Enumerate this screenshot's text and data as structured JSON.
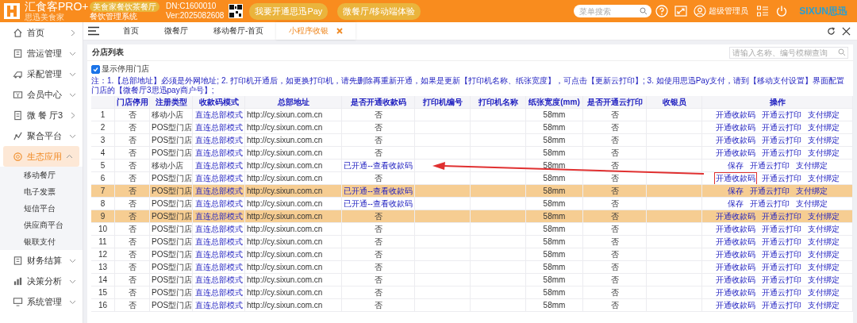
{
  "header": {
    "brand": "汇食客PRO+",
    "brand_sub": "思迅美食家",
    "edition_badge": "美食家餐饮茶餐厅",
    "system_name": "餐饮管理系统",
    "dn": "DN:C1600010",
    "version": "Ver:2025082608",
    "buttons": [
      "我要开通思迅Pay",
      "微餐厅/移动端体验"
    ],
    "search_placeholder": "菜单搜索",
    "user": "超级管理员",
    "logo_text": "SIXUN思迅"
  },
  "sidebar": {
    "items": [
      {
        "label": "首页",
        "kind": "link",
        "selected": false
      },
      {
        "label": "营运管理",
        "kind": "group",
        "expanded": false,
        "selected": false
      },
      {
        "label": "采配管理",
        "kind": "group",
        "expanded": false,
        "selected": false
      },
      {
        "label": "会员中心",
        "kind": "group",
        "expanded": false,
        "selected": false
      },
      {
        "label": "微 餐 厅3",
        "kind": "link",
        "selected": false
      },
      {
        "label": "聚合平台",
        "kind": "group",
        "expanded": false,
        "selected": false
      },
      {
        "label": "生态应用",
        "kind": "group",
        "expanded": true,
        "selected": true,
        "children": [
          {
            "label": "移动餐厅"
          },
          {
            "label": "电子发票"
          },
          {
            "label": "短信平台"
          },
          {
            "label": "供应商平台"
          },
          {
            "label": "银联支付"
          }
        ]
      },
      {
        "label": "财务结算",
        "kind": "group",
        "expanded": false,
        "selected": false
      },
      {
        "label": "决策分析",
        "kind": "group",
        "expanded": false,
        "selected": false
      },
      {
        "label": "系统管理",
        "kind": "group",
        "expanded": false,
        "selected": false
      }
    ]
  },
  "tabs": [
    {
      "label": "首页",
      "selected": false
    },
    {
      "label": "微餐厅",
      "selected": false
    },
    {
      "label": "移动餐厅-首页",
      "selected": false
    },
    {
      "label": "小程序收银",
      "selected": true
    }
  ],
  "panel": {
    "title": "分店列表",
    "search_placeholder": "请输入名称、编号模糊查询"
  },
  "show_disabled": {
    "label": "显示停用门店",
    "checked": true
  },
  "note": "注：1.【总部地址】必须是外网地址;  2. 打印机开通后，如更换打印机，请先删除再重新开通，如果是更新【打印机名称、纸张宽度】，可点击【更新云打印】;   3. 如使用思迅Pay支付，请到【移动支付设置】界面配置门店的【微餐厅3思迅pay商户号】;",
  "table": {
    "columns": [
      "门店停用",
      "注册类型",
      "收款码模式",
      "总部地址",
      "是否开通收款码",
      "打印机编号",
      "打印机名称",
      "纸张宽度(mm)",
      "是否开通云打印",
      "收银员",
      "操作"
    ],
    "rows": [
      {
        "index": "1",
        "disabled": "否",
        "type": "移动小店",
        "mode": "直连总部模式",
        "address": "http://cy.sixun.com.cn",
        "qr": "否",
        "qr_opened": false,
        "paper": "58mm",
        "cloud_print": "否",
        "actions": [
          "开通收款码",
          "开通云打印",
          "支付绑定"
        ],
        "selected": false,
        "highlighted": false
      },
      {
        "index": "2",
        "disabled": "否",
        "type": "POS型门店",
        "mode": "直连总部模式",
        "address": "http://cy.sixun.com.cn",
        "qr": "否",
        "qr_opened": false,
        "paper": "58mm",
        "cloud_print": "否",
        "actions": [
          "开通收款码",
          "开通云打印",
          "支付绑定"
        ],
        "selected": false,
        "highlighted": false
      },
      {
        "index": "3",
        "disabled": "否",
        "type": "POS型门店",
        "mode": "直连总部模式",
        "address": "http://cy.sixun.com.cn",
        "qr": "否",
        "qr_opened": false,
        "paper": "58mm",
        "cloud_print": "否",
        "actions": [
          "开通收款码",
          "开通云打印",
          "支付绑定"
        ],
        "selected": false,
        "highlighted": false
      },
      {
        "index": "4",
        "disabled": "否",
        "type": "POS型门店",
        "mode": "直连总部模式",
        "address": "http://cy.sixun.com.cn",
        "qr": "否",
        "qr_opened": false,
        "paper": "58mm",
        "cloud_print": "否",
        "actions": [
          "开通收款码",
          "开通云打印",
          "支付绑定"
        ],
        "selected": false,
        "highlighted": false
      },
      {
        "index": "5",
        "disabled": "否",
        "type": "移动小店",
        "mode": "直连总部模式",
        "address": "http://cy.sixun.com.cn",
        "qr": "已开通--查看收款码",
        "qr_opened": true,
        "paper": "58mm",
        "cloud_print": "否",
        "actions": [
          "保存",
          "开通云打印",
          "支付绑定"
        ],
        "selected": false,
        "highlighted": false
      },
      {
        "index": "6",
        "disabled": "否",
        "type": "POS型门店",
        "mode": "直连总部模式",
        "address": "http://cy.sixun.com.cn",
        "qr": "否",
        "qr_opened": false,
        "paper": "58mm",
        "cloud_print": "否",
        "actions": [
          "开通收款码",
          "开通云打印",
          "支付绑定"
        ],
        "selected": false,
        "highlighted": true
      },
      {
        "index": "7",
        "disabled": "否",
        "type": "POS型门店",
        "mode": "直连总部模式",
        "address": "http://cy.sixun.com.cn",
        "qr": "已开通--查看收款码",
        "qr_opened": true,
        "paper": "58mm",
        "cloud_print": "否",
        "actions": [
          "保存",
          "开通云打印",
          "支付绑定"
        ],
        "selected": true,
        "highlighted": false
      },
      {
        "index": "8",
        "disabled": "否",
        "type": "POS型门店",
        "mode": "直连总部模式",
        "address": "http://cy.sixun.com.cn",
        "qr": "已开通--查看收款码",
        "qr_opened": true,
        "paper": "58mm",
        "cloud_print": "否",
        "actions": [
          "保存",
          "开通云打印",
          "支付绑定"
        ],
        "selected": false,
        "highlighted": false
      },
      {
        "index": "9",
        "disabled": "否",
        "type": "POS型门店",
        "mode": "直连总部模式",
        "address": "http://cy.sixun.com.cn",
        "qr": "否",
        "qr_opened": false,
        "paper": "58mm",
        "cloud_print": "否",
        "actions": [
          "开通收款码",
          "开通云打印",
          "支付绑定"
        ],
        "selected": true,
        "highlighted": false
      },
      {
        "index": "10",
        "disabled": "否",
        "type": "POS型门店",
        "mode": "直连总部模式",
        "address": "http://cy.sixun.com.cn",
        "qr": "否",
        "qr_opened": false,
        "paper": "58mm",
        "cloud_print": "否",
        "actions": [
          "开通收款码",
          "开通云打印",
          "支付绑定"
        ],
        "selected": false,
        "highlighted": false
      },
      {
        "index": "11",
        "disabled": "否",
        "type": "POS型门店",
        "mode": "直连总部模式",
        "address": "http://cy.sixun.com.cn",
        "qr": "否",
        "qr_opened": false,
        "paper": "58mm",
        "cloud_print": "否",
        "actions": [
          "开通收款码",
          "开通云打印",
          "支付绑定"
        ],
        "selected": false,
        "highlighted": false
      },
      {
        "index": "12",
        "disabled": "否",
        "type": "POS型门店",
        "mode": "直连总部模式",
        "address": "http://cy.sixun.com.cn",
        "qr": "否",
        "qr_opened": false,
        "paper": "58mm",
        "cloud_print": "否",
        "actions": [
          "开通收款码",
          "开通云打印",
          "支付绑定"
        ],
        "selected": false,
        "highlighted": false
      },
      {
        "index": "13",
        "disabled": "否",
        "type": "POS型门店",
        "mode": "直连总部模式",
        "address": "http://cy.sixun.com.cn",
        "qr": "否",
        "qr_opened": false,
        "paper": "58mm",
        "cloud_print": "否",
        "actions": [
          "开通收款码",
          "开通云打印",
          "支付绑定"
        ],
        "selected": false,
        "highlighted": false
      },
      {
        "index": "14",
        "disabled": "否",
        "type": "POS型门店",
        "mode": "直连总部模式",
        "address": "http://cy.sixun.com.cn",
        "qr": "否",
        "qr_opened": false,
        "paper": "58mm",
        "cloud_print": "否",
        "actions": [
          "开通收款码",
          "开通云打印",
          "支付绑定"
        ],
        "selected": false,
        "highlighted": false
      },
      {
        "index": "15",
        "disabled": "否",
        "type": "POS型门店",
        "mode": "直连总部模式",
        "address": "http://cy.sixun.com.cn",
        "qr": "否",
        "qr_opened": false,
        "paper": "58mm",
        "cloud_print": "否",
        "actions": [
          "开通收款码",
          "开通云打印",
          "支付绑定"
        ],
        "selected": false,
        "highlighted": false
      },
      {
        "index": "16",
        "disabled": "否",
        "type": "POS型门店",
        "mode": "直连总部模式",
        "address": "http://cy.sixun.com.cn",
        "qr": "否",
        "qr_opened": false,
        "paper": "58mm",
        "cloud_print": "否",
        "actions": [
          "开通收款码",
          "开通云打印",
          "支付绑定"
        ],
        "selected": false,
        "highlighted": false
      }
    ]
  }
}
